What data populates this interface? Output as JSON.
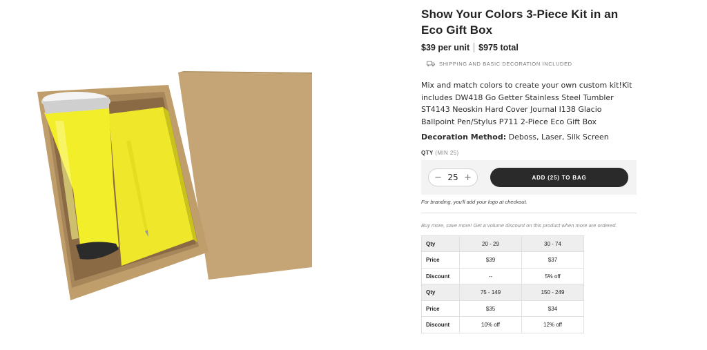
{
  "product": {
    "title": "Show Your Colors 3-Piece Kit in an Eco Gift Box",
    "price_per_unit": "$39 per unit",
    "price_total": "$975 total",
    "shipping_note": "SHIPPING AND BASIC DECORATION INCLUDED",
    "description": "Mix and match colors to create your own custom kit!Kit includes DW418 Go Getter Stainless Steel Tumbler ST4143 Neoskin Hard Cover Journal I138 Glacio Ballpoint Pen/Stylus P711 2-Piece Eco Gift Box",
    "decoration_label": "Decoration Method:",
    "decoration_value": "Deboss, Laser, Silk Screen",
    "image_icon": "product-photo-yellow-kit"
  },
  "quantity": {
    "label": "QTY",
    "min_note": "(MIN 25)",
    "value": "25",
    "minus": "−",
    "plus": "+",
    "add_button": "ADD (25) TO BAG",
    "branding_note": "For branding, you'll add your logo at checkout."
  },
  "volume": {
    "note": "Buy more, save more! Get a volume discount on this product when more are ordered.",
    "table": [
      {
        "qty": "Qty",
        "price": "Price",
        "discount": "Discount",
        "cols": [
          {
            "qty": "20 - 29",
            "price": "$39",
            "discount": "--"
          },
          {
            "qty": "30 - 74",
            "price": "$37",
            "discount": "5% off"
          }
        ]
      },
      {
        "qty": "Qty",
        "price": "Price",
        "discount": "Discount",
        "cols": [
          {
            "qty": "75 - 149",
            "price": "$35",
            "discount": "10% off"
          },
          {
            "qty": "150 - 249",
            "price": "$34",
            "discount": "12% off"
          }
        ]
      }
    ]
  },
  "colors": {
    "accent": "#f2ee2a",
    "kraft": "#c7a77a",
    "button": "#2a2a2a"
  }
}
